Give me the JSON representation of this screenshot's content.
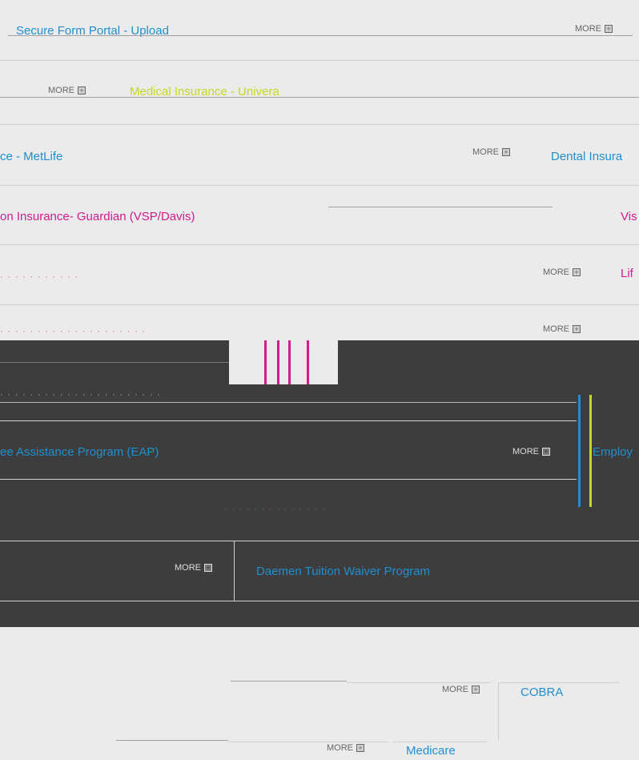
{
  "colors": {
    "accent_blue": "#1f8fd0",
    "accent_pink": "#d11b8e",
    "accent_yellow": "#c7d820",
    "dark_band": "#3d3d3d"
  },
  "rows": [
    {
      "title": "Secure Form Portal - Upload",
      "more": "MORE",
      "icon": "plus-square-icon"
    },
    {
      "title": "Medical Insurance - Univera",
      "more": "MORE",
      "icon": "plus-square-icon"
    },
    {
      "title": "Dental Insurance - MetLife",
      "more": "MORE",
      "icon": "plus-square-icon"
    },
    {
      "title": "Vision Insurance- Guardian (VSP/Davis)",
      "more": "MORE",
      "icon": "plus-square-icon"
    },
    {
      "title": "Life Insurance",
      "more": "MORE",
      "icon": "plus-square-icon"
    },
    {
      "title": "Employee Assistance Program (EAP)",
      "more": "MORE",
      "icon": "plus-square-icon"
    },
    {
      "title": "Daemen Tuition Waiver Program",
      "more": "MORE",
      "icon": "plus-square-icon"
    },
    {
      "title": "COBRA",
      "more": "MORE",
      "icon": "plus-square-icon"
    },
    {
      "title": "Medicare",
      "more": "MORE",
      "icon": "plus-square-icon"
    }
  ],
  "visible": {
    "row0_title": "Secure Form Portal - Upload",
    "row1_title": "Medical Insurance - Univera",
    "row2_left": "ce - MetLife",
    "row2_right": "Dental Insura",
    "row3_left": "on Insurance- Guardian (VSP/Davis)",
    "row3_right": "Vis",
    "row4_right": "Lif",
    "row6_left": "ee Assistance Program (EAP)",
    "row6_right": "Employ",
    "row7_title": "Daemen Tuition Waiver Program",
    "row8_title": "COBRA",
    "row9_title": "Medicare"
  }
}
